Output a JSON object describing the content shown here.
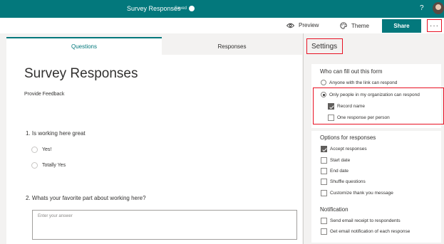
{
  "topbar": {
    "title": "Survey Responses",
    "saved": "Saved",
    "help": "?"
  },
  "commands": {
    "preview": "Preview",
    "theme": "Theme",
    "share": "Share",
    "more": "···"
  },
  "tabs": {
    "questions": "Questions",
    "responses": "Responses"
  },
  "form": {
    "title": "Survey Responses",
    "description": "Provide Feedback",
    "questions": [
      {
        "number": "1.",
        "title": "Is working here great",
        "options": [
          "Yes!",
          "Totally Yes"
        ]
      },
      {
        "number": "2.",
        "title": "Whats your favorite part about working here?",
        "placeholder": "Enter your answer"
      }
    ]
  },
  "settings": {
    "title": "Settings",
    "who": {
      "heading": "Who can fill out this form",
      "options": [
        {
          "label": "Anyone with the link can respond",
          "selected": false
        },
        {
          "label": "Only people in my organization can respond",
          "selected": true
        }
      ],
      "sub_options": [
        {
          "label": "Record name",
          "checked": true
        },
        {
          "label": "One response per person",
          "checked": false
        }
      ]
    },
    "responses": {
      "heading": "Options for responses",
      "options": [
        {
          "label": "Accept responses",
          "checked": true
        },
        {
          "label": "Start date",
          "checked": false
        },
        {
          "label": "End date",
          "checked": false
        },
        {
          "label": "Shuffle questions",
          "checked": false
        },
        {
          "label": "Customize thank you message",
          "checked": false
        }
      ]
    },
    "notification": {
      "heading": "Notification",
      "options": [
        {
          "label": "Send email receipt to respondents",
          "checked": false
        },
        {
          "label": "Get email notification of each response",
          "checked": false
        }
      ]
    }
  },
  "colors": {
    "brand": "#03787c",
    "highlight": "#e81123"
  }
}
